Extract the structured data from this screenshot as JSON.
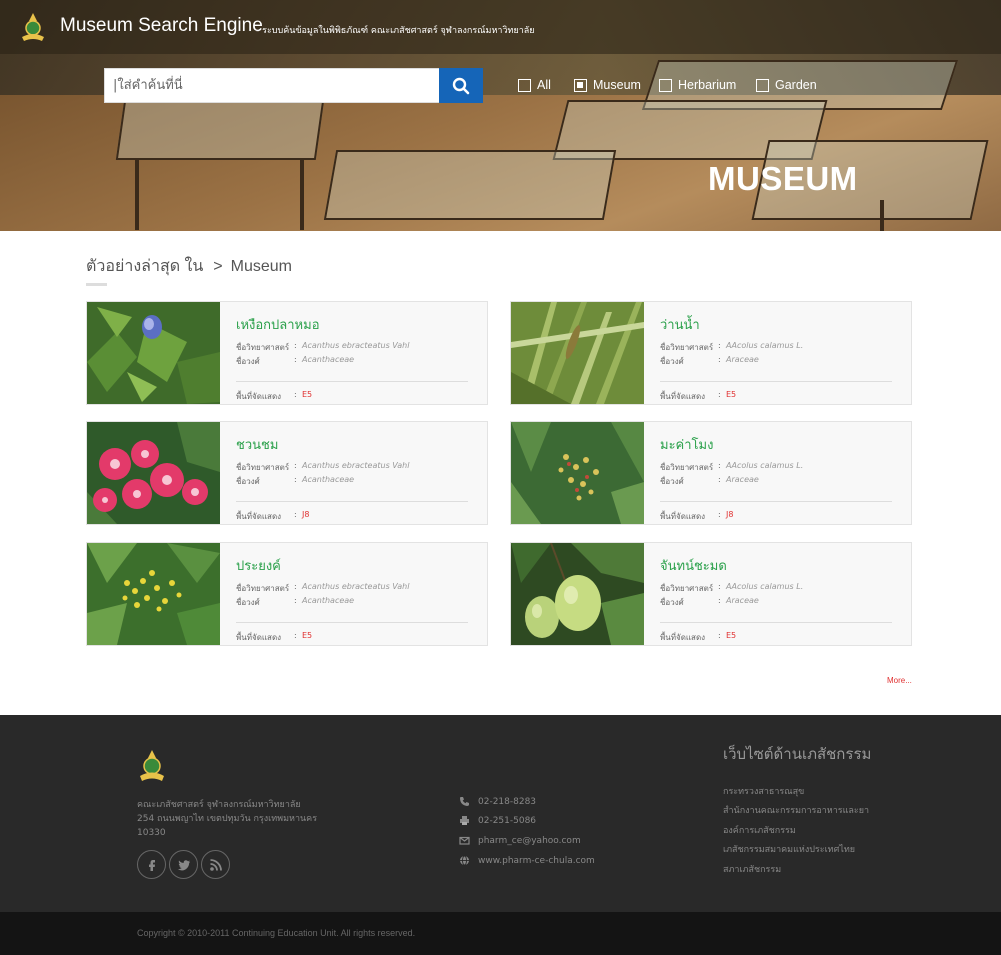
{
  "header": {
    "brand": "Museum Search Engine",
    "subtitle": "- ระบบค้นข้อมูลในพิพิธภัณฑ์ คณะเภสัชศาสตร์ จุฬาลงกรณ์มหาวิทยาลัย",
    "hero_title": "MUSEUM"
  },
  "search": {
    "placeholder": "|ใส่คำค้นที่นี่",
    "button_icon": "search-icon"
  },
  "filters": [
    {
      "label": "All",
      "checked": false
    },
    {
      "label": "Museum",
      "checked": true
    },
    {
      "label": "Herbarium",
      "checked": false
    },
    {
      "label": "Garden",
      "checked": false
    }
  ],
  "breadcrumb": {
    "label": "ตัวอย่างล่าสุด ใน",
    "separator": ">",
    "current": "Museum"
  },
  "field_labels": {
    "scientific": "ชื่อวิทยาศาสตร์",
    "family": "ชื่อวงศ์",
    "location": "พื้นที่จัดแสดง",
    "colon": ":"
  },
  "cards": [
    {
      "name": "เหงือกปลาหมอ",
      "scientific": "Acanthus ebracteatus Vahl",
      "family": "Acanthaceae",
      "location": "E5",
      "photo": "purple-flower-leaves"
    },
    {
      "name": "ว่านน้ำ",
      "scientific": "AAcolus calamus L.",
      "family": "Araceae",
      "location": "E5",
      "photo": "reed-grass"
    },
    {
      "name": "ชวนชม",
      "scientific": "Acanthus ebracteatus Vahl",
      "family": "Acanthaceae",
      "location": "J8",
      "photo": "pink-flowers"
    },
    {
      "name": "มะค่าโมง",
      "scientific": "AAcolus calamus L.",
      "family": "Araceae",
      "location": "J8",
      "photo": "yellow-green-blossom"
    },
    {
      "name": "ประยงค์",
      "scientific": "Acanthus ebracteatus Vahl",
      "family": "Acanthaceae",
      "location": "E5",
      "photo": "yellow-buds"
    },
    {
      "name": "จันทน์ชะมด",
      "scientific": "AAcolus calamus L.",
      "family": "Araceae",
      "location": "E5",
      "photo": "green-fruits"
    }
  ],
  "more_link": "More...",
  "footer": {
    "address_lines": [
      "คณะเภสัชศาสตร์ จุฬาลงกรณ์มหาวิทยาลัย",
      "254 ถนนพญาไท เขตปทุมวัน กรุงเทพมหานคร",
      "10330"
    ],
    "social": [
      "facebook-icon",
      "twitter-icon",
      "rss-icon"
    ],
    "contacts": [
      {
        "icon": "phone-icon",
        "text": "02-218-8283"
      },
      {
        "icon": "fax-icon",
        "text": "02-251-5086"
      },
      {
        "icon": "mail-icon",
        "text": "pharm_ce@yahoo.com"
      },
      {
        "icon": "globe-icon",
        "text": "www.pharm-ce-chula.com"
      }
    ],
    "links_title": "เว็บไซต์ด้านเภสัชกรรม",
    "links": [
      "กระทรวงสาธารณสุข",
      "สำนักงานคณะกรรมการอาหารและยา",
      "องค์การเภสัชกรรม",
      "เภสัชกรรมสมาคมแห่งประเทศไทย",
      "สภาเภสัชกรรม"
    ],
    "copyright": "Copyright © 2010-2011 Continuing Education Unit. All rights reserved."
  }
}
